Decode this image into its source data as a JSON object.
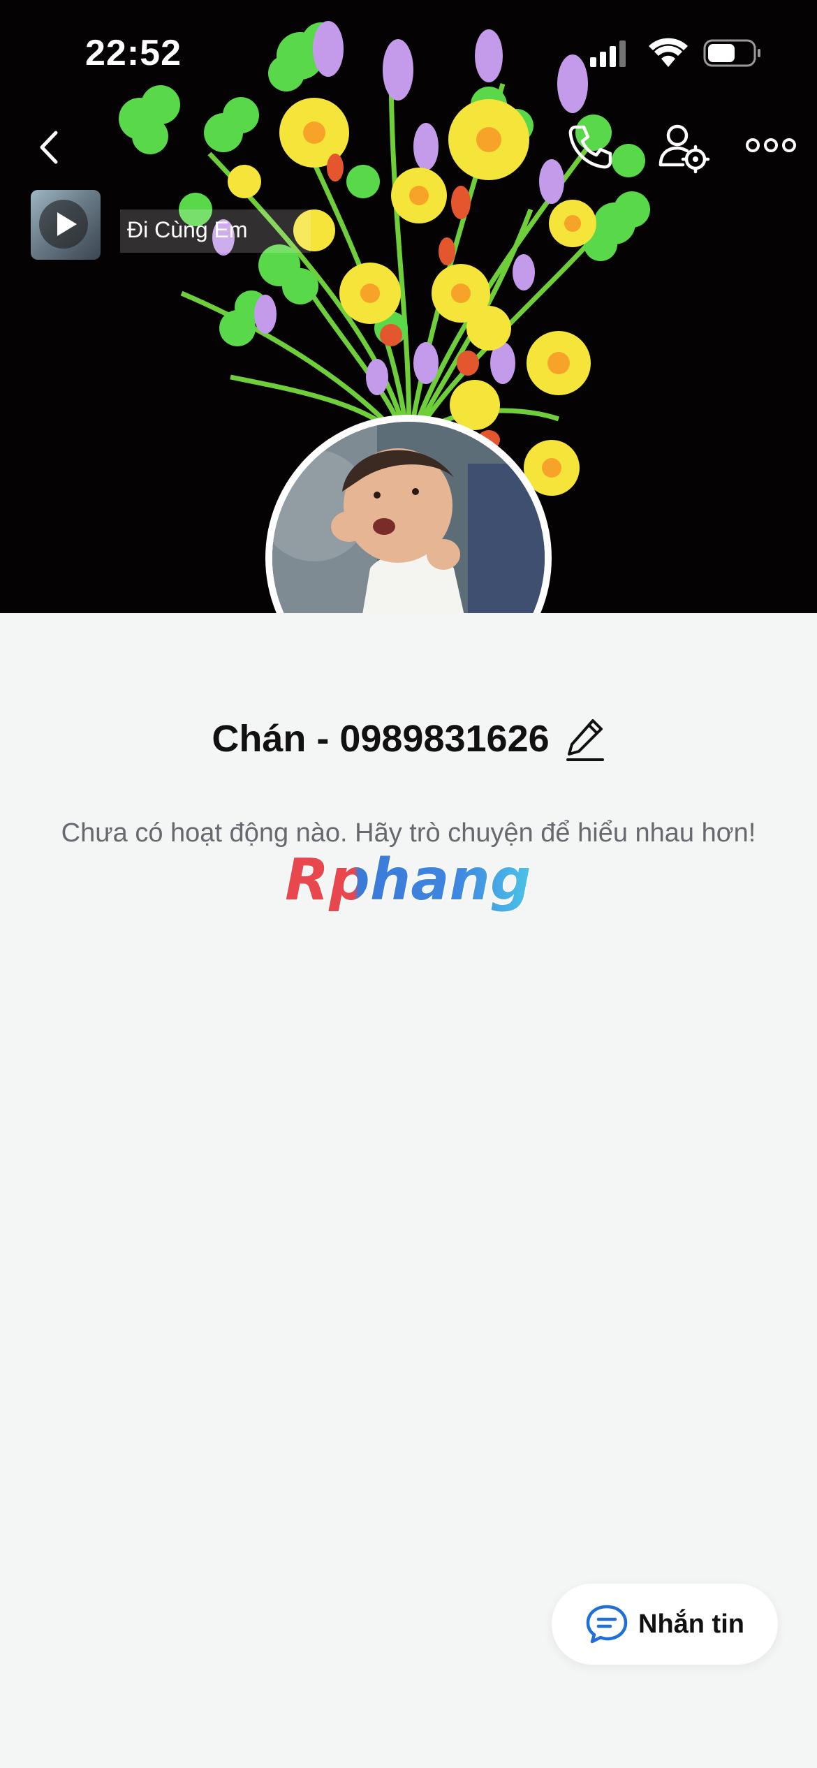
{
  "status_bar": {
    "time": "22:52"
  },
  "nav": {
    "back_icon": "chevron-left-icon",
    "call_icon": "phone-icon",
    "settings_icon": "user-settings-icon",
    "more_icon": "more-horizontal-icon"
  },
  "music": {
    "song_title": "Đi Cùng Em",
    "icon": "play-icon"
  },
  "profile": {
    "name": "Chán - 0989831626",
    "empty_message": "Chưa có hoạt động nào. Hãy trò chuyện để hiểu nhau hơn!"
  },
  "watermark": {
    "text": "Rphang"
  },
  "chat_button": {
    "label": "Nhắn tin",
    "icon": "chat-bubble-icon"
  },
  "colors": {
    "background": "#f4f5f5",
    "cover": "#050203",
    "chat_icon": "#1f6fd6"
  }
}
